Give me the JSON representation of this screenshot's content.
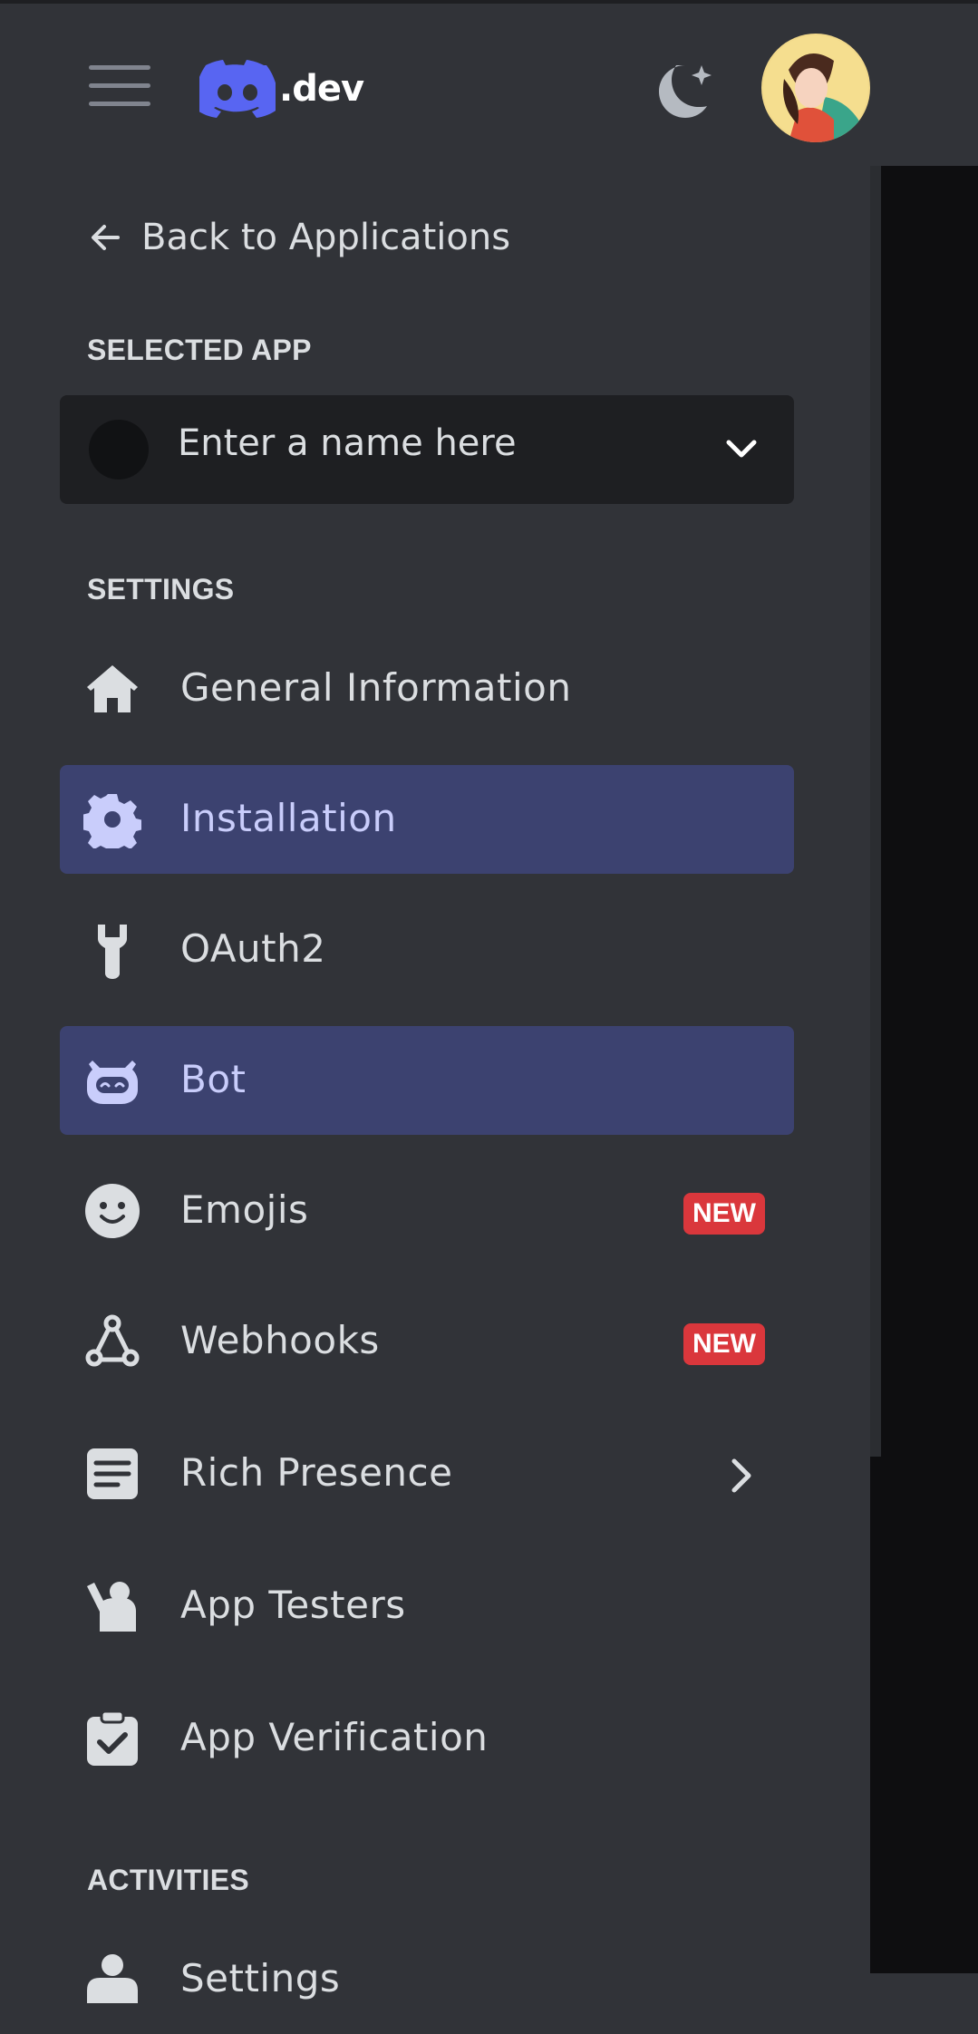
{
  "header": {
    "logo_text": ".dev",
    "menu_icon": "hamburger-icon",
    "theme_icon": "moon-stars-icon",
    "avatar_icon": "user-avatar"
  },
  "sidebar": {
    "back_label": "Back to Applications",
    "selected_app_heading": "SELECTED APP",
    "app_select": {
      "placeholder": "Enter a name here"
    },
    "settings_heading": "SETTINGS",
    "items": [
      {
        "label": "General Information",
        "icon": "home-icon",
        "active": false
      },
      {
        "label": "Installation",
        "icon": "gear-icon",
        "active": true
      },
      {
        "label": "OAuth2",
        "icon": "wrench-icon",
        "active": false
      },
      {
        "label": "Bot",
        "icon": "robot-icon",
        "active": true
      },
      {
        "label": "Emojis",
        "icon": "smiley-icon",
        "active": false,
        "badge": "NEW"
      },
      {
        "label": "Webhooks",
        "icon": "webhook-icon",
        "active": false,
        "badge": "NEW"
      },
      {
        "label": "Rich Presence",
        "icon": "document-icon",
        "active": false,
        "has_submenu": true
      },
      {
        "label": "App Testers",
        "icon": "person-icon",
        "active": false
      },
      {
        "label": "App Verification",
        "icon": "clipboard-check-icon",
        "active": false
      }
    ],
    "activities_heading": "ACTIVITIES",
    "activities_items": [
      {
        "label": "Settings",
        "icon": "gear-person-icon"
      }
    ]
  },
  "colors": {
    "background": "#313338",
    "active_item": "#3c4270",
    "active_text": "#c9cdfb",
    "badge": "#da373c",
    "brand": "#5865f2"
  }
}
